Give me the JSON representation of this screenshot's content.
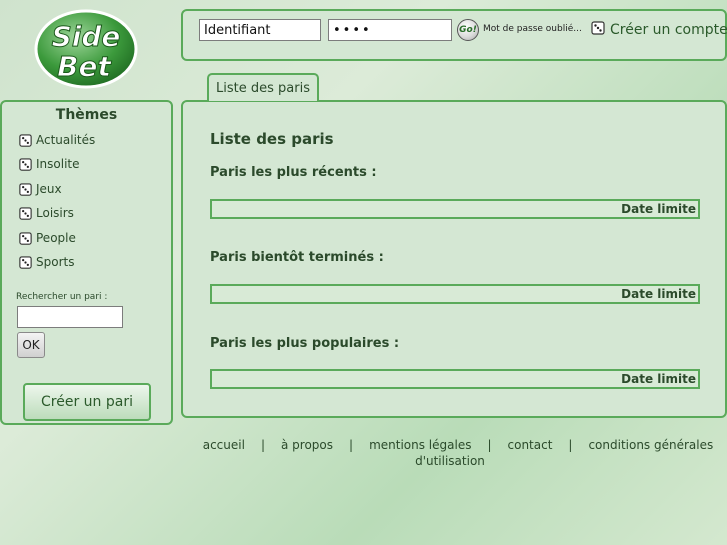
{
  "header": {
    "logo_text_top": "Side",
    "logo_text_bottom": "Bet",
    "login": {
      "username_value": "Identifiant",
      "password_value": "••••",
      "go_label": "Go!",
      "forgot_password": "Mot de passe oublié...",
      "create_account": "Créer un compte"
    }
  },
  "tab": {
    "label": "Liste des paris"
  },
  "sidebar": {
    "title": "Thèmes",
    "items": [
      {
        "label": "Actualités"
      },
      {
        "label": "Insolite"
      },
      {
        "label": "Jeux"
      },
      {
        "label": "Loisirs"
      },
      {
        "label": "People"
      },
      {
        "label": "Sports"
      }
    ],
    "search_label": "Rechercher un pari :",
    "search_value": "",
    "ok_label": "OK",
    "create_bet_label": "Créer un pari"
  },
  "main": {
    "title": "Liste des paris",
    "sections": [
      {
        "title": "Paris les plus récents :",
        "column": "Date limite"
      },
      {
        "title": "Paris bientôt terminés :",
        "column": "Date limite"
      },
      {
        "title": "Paris les plus populaires :",
        "column": "Date limite"
      }
    ]
  },
  "footer": {
    "links": [
      "accueil",
      "à propos",
      "mentions légales",
      "contact",
      "conditions générales d'utilisation"
    ],
    "separator": "|"
  },
  "colors": {
    "accent_border": "#5aaa5a",
    "panel_bg": "#d4e7d3",
    "text": "#2b4a2b"
  }
}
